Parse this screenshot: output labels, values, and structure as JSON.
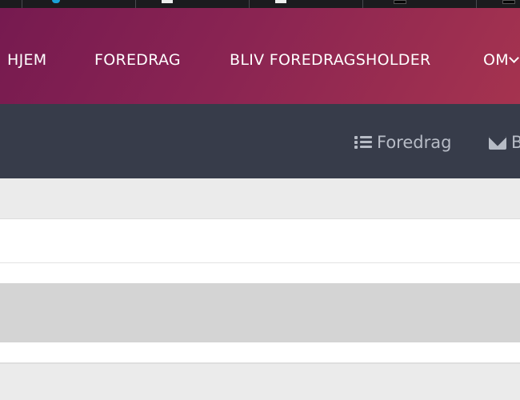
{
  "nav": {
    "items": [
      {
        "label": "HJEM"
      },
      {
        "label": "FOREDRAG"
      },
      {
        "label": "BLIV FOREDRAGSHOLDER"
      },
      {
        "label": "OM"
      }
    ]
  },
  "subnav": {
    "foredrag_label": "Foredrag",
    "mail_label": "B"
  },
  "colors": {
    "nav_gradient_start": "#761a50",
    "nav_gradient_end": "#a5334f",
    "subbar_bg": "#373c4a",
    "subbar_text": "#b7bcc6"
  },
  "icons": [
    "list-icon",
    "envelope-icon",
    "chevron-down-icon"
  ]
}
